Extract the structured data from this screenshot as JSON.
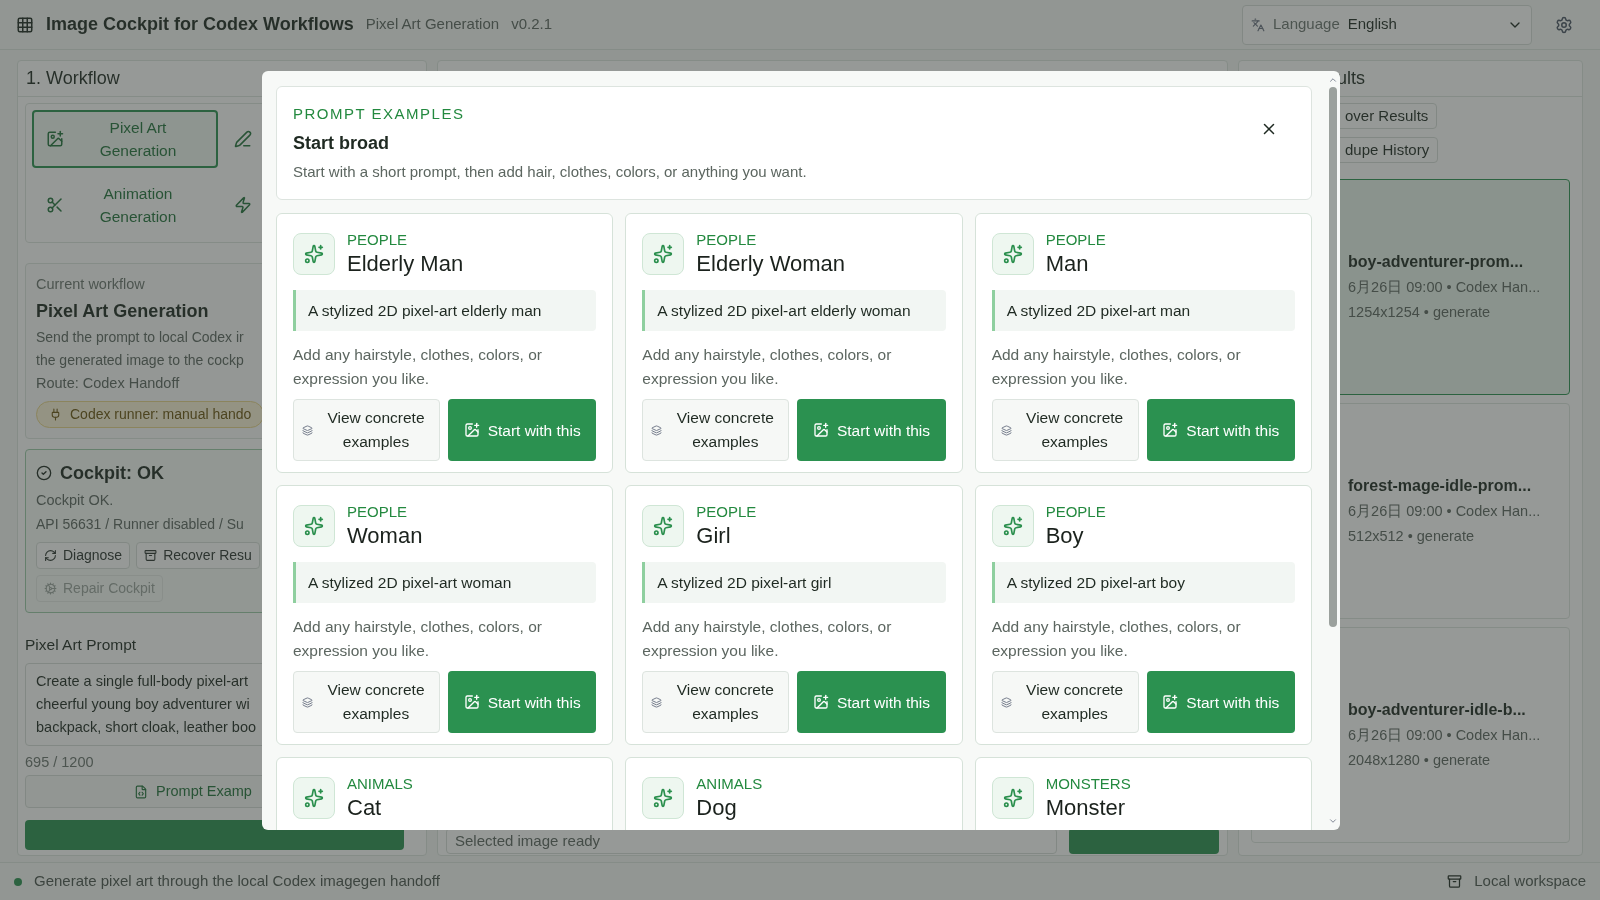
{
  "header": {
    "title": "Image Cockpit for Codex Workflows",
    "subtitle": "Pixel Art Generation",
    "version": "v0.2.1",
    "language_label": "Language",
    "language_value": "English"
  },
  "workflow_panel": {
    "title": "1. Workflow",
    "workflows": [
      {
        "label": "Pixel Art Generation",
        "selected": true
      },
      {
        "label": "Animation Generation",
        "selected": false
      }
    ],
    "current": {
      "caption": "Current workflow",
      "name": "Pixel Art Generation",
      "description_lines": [
        "Send the prompt to local Codex ir",
        "the generated image to the cockp"
      ],
      "route": "Route: Codex Handoff",
      "runner_badge": "Codex runner: manual hando"
    },
    "cockpit": {
      "title": "Cockpit: OK",
      "status": "Cockpit OK.",
      "details": "API 56631 / Runner disabled / Su",
      "buttons": [
        {
          "label": "Diagnose",
          "disabled": false
        },
        {
          "label": "Recover Resu",
          "disabled": false
        },
        {
          "label": "Repair Cockpit",
          "disabled": true
        }
      ]
    },
    "prompt": {
      "label": "Pixel Art Prompt",
      "lines": [
        "Create a single full-body pixel-art",
        "cheerful young boy adventurer wi",
        "backpack, short cloak, leather boo"
      ],
      "counter": "695 / 1200",
      "examples_button": "Prompt Examp"
    }
  },
  "preview_panel": {
    "selection_status": "Selected image ready"
  },
  "results_panel": {
    "title": "ults",
    "buttons": [
      "over Results",
      "dupe History"
    ],
    "items": [
      {
        "title": "boy-adventurer-prom...",
        "meta": "6月26日 09:00 • Codex Han...",
        "info": "1254x1254 • generate",
        "selected": true
      },
      {
        "title": "forest-mage-idle-prom...",
        "meta": "6月26日 09:00 • Codex Han...",
        "info": "512x512 • generate",
        "selected": false
      },
      {
        "title": "boy-adventurer-idle-b...",
        "meta": "6月26日 09:00 • Codex Han...",
        "info": "2048x1280 • generate",
        "selected": false
      }
    ]
  },
  "status_bar": {
    "message": "Generate pixel art through the local Codex imagegen handoff",
    "workspace": "Local workspace"
  },
  "modal": {
    "eyebrow": "PROMPT EXAMPLES",
    "title": "Start broad",
    "description": "Start with a short prompt, then add hair, clothes, colors, or anything you want.",
    "examples": [
      {
        "category": "PEOPLE",
        "title": "Elderly Man",
        "prompt": "A stylized 2D pixel-art elderly man",
        "hint": "Add any hairstyle, clothes, colors, or expression you like.",
        "view_button": "View concrete examples",
        "start_button": "Start with this"
      },
      {
        "category": "PEOPLE",
        "title": "Elderly Woman",
        "prompt": "A stylized 2D pixel-art elderly woman",
        "hint": "Add any hairstyle, clothes, colors, or expression you like.",
        "view_button": "View concrete examples",
        "start_button": "Start with this"
      },
      {
        "category": "PEOPLE",
        "title": "Man",
        "prompt": "A stylized 2D pixel-art man",
        "hint": "Add any hairstyle, clothes, colors, or expression you like.",
        "view_button": "View concrete examples",
        "start_button": "Start with this"
      },
      {
        "category": "PEOPLE",
        "title": "Woman",
        "prompt": "A stylized 2D pixel-art woman",
        "hint": "Add any hairstyle, clothes, colors, or expression you like.",
        "view_button": "View concrete examples",
        "start_button": "Start with this"
      },
      {
        "category": "PEOPLE",
        "title": "Girl",
        "prompt": "A stylized 2D pixel-art girl",
        "hint": "Add any hairstyle, clothes, colors, or expression you like.",
        "view_button": "View concrete examples",
        "start_button": "Start with this"
      },
      {
        "category": "PEOPLE",
        "title": "Boy",
        "prompt": "A stylized 2D pixel-art boy",
        "hint": "Add any hairstyle, clothes, colors, or expression you like.",
        "view_button": "View concrete examples",
        "start_button": "Start with this"
      },
      {
        "category": "ANIMALS",
        "title": "Cat"
      },
      {
        "category": "ANIMALS",
        "title": "Dog"
      },
      {
        "category": "MONSTERS",
        "title": "Monster"
      }
    ]
  }
}
